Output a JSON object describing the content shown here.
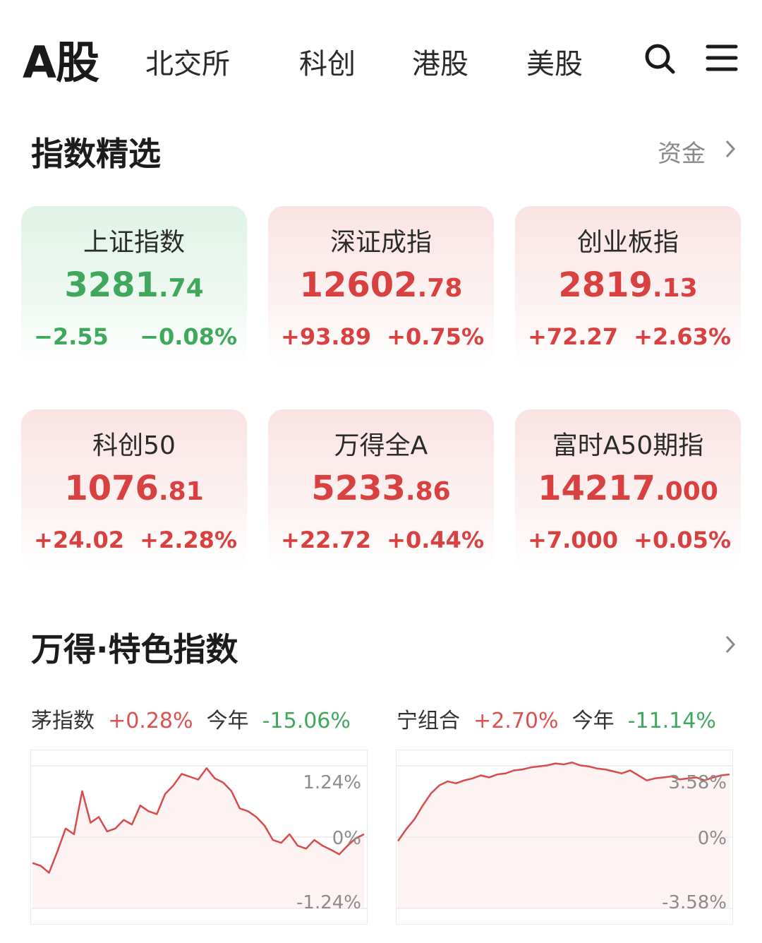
{
  "nav": {
    "active": "A股",
    "tabs": [
      "北交所",
      "科创",
      "港股",
      "美股"
    ],
    "search_icon": "search-icon",
    "menu_icon": "menu-icon"
  },
  "section1": {
    "title": "指数精选",
    "link": "资金"
  },
  "cards": [
    {
      "name": "上证指数",
      "int": "3281",
      "dec": ".74",
      "change": "−2.55",
      "pct": "−0.08%",
      "trend": "down"
    },
    {
      "name": "深证成指",
      "int": "12602",
      "dec": ".78",
      "change": "+93.89",
      "pct": "+0.75%",
      "trend": "up"
    },
    {
      "name": "创业板指",
      "int": "2819",
      "dec": ".13",
      "change": "+72.27",
      "pct": "+2.63%",
      "trend": "up"
    },
    {
      "name": "科创50",
      "int": "1076",
      "dec": ".81",
      "change": "+24.02",
      "pct": "+2.28%",
      "trend": "up"
    },
    {
      "name": "万得全A",
      "int": "5233",
      "dec": ".86",
      "change": "+22.72",
      "pct": "+0.44%",
      "trend": "up"
    },
    {
      "name": "富时A50期指",
      "int": "14217",
      "dec": ".000",
      "change": "+7.000",
      "pct": "+0.05%",
      "trend": "up"
    }
  ],
  "section2": {
    "title": "万得·特色指数"
  },
  "features": [
    {
      "name": "茅指数",
      "day": "+0.28%",
      "ytd_label": "今年",
      "ytd": "-15.06%",
      "axis": {
        "top": "1.24%",
        "mid": "0%",
        "bottom": "-1.24%"
      }
    },
    {
      "name": "宁组合",
      "day": "+2.70%",
      "ytd_label": "今年",
      "ytd": "-11.14%",
      "axis": {
        "top": "3.58%",
        "mid": "0%",
        "bottom": "-3.58%"
      }
    }
  ],
  "colors": {
    "up": "#d94040",
    "down": "#3fa85d",
    "line": "#d94a4a"
  },
  "chart_data": [
    {
      "type": "line",
      "title": "茅指数",
      "ylim": [
        -1.24,
        1.24
      ],
      "x": [
        0,
        1,
        2,
        3,
        4,
        5,
        6,
        7,
        8,
        9,
        10,
        11,
        12,
        13,
        14,
        15,
        16,
        17,
        18,
        19,
        20,
        21,
        22,
        23,
        24,
        25,
        26,
        27,
        28,
        29,
        30,
        31,
        32,
        33,
        34,
        35,
        36,
        37,
        38,
        39,
        40
      ],
      "series": [
        {
          "values": [
            -0.45,
            -0.5,
            -0.62,
            -0.25,
            0.15,
            0.05,
            0.8,
            0.25,
            0.35,
            0.1,
            0.15,
            0.3,
            0.22,
            0.55,
            0.45,
            0.4,
            0.75,
            0.9,
            1.1,
            1.05,
            1.0,
            1.2,
            1.02,
            0.95,
            0.8,
            0.5,
            0.45,
            0.35,
            0.2,
            -0.05,
            -0.1,
            0.05,
            -0.15,
            -0.2,
            -0.05,
            -0.15,
            -0.22,
            -0.3,
            -0.15,
            -0.02,
            0.05
          ]
        }
      ]
    },
    {
      "type": "line",
      "title": "宁组合",
      "ylim": [
        -3.58,
        3.58
      ],
      "x": [
        0,
        1,
        2,
        3,
        4,
        5,
        6,
        7,
        8,
        9,
        10,
        11,
        12,
        13,
        14,
        15,
        16,
        17,
        18,
        19,
        20,
        21,
        22,
        23,
        24,
        25,
        26,
        27,
        28,
        29,
        30,
        31,
        32,
        33,
        34,
        35,
        36,
        37,
        38,
        39,
        40
      ],
      "series": [
        {
          "values": [
            -0.2,
            0.4,
            0.9,
            1.6,
            2.2,
            2.6,
            2.8,
            2.7,
            2.85,
            2.95,
            3.1,
            3.0,
            3.15,
            3.2,
            3.35,
            3.4,
            3.5,
            3.55,
            3.6,
            3.7,
            3.65,
            3.75,
            3.6,
            3.55,
            3.45,
            3.4,
            3.3,
            3.2,
            3.35,
            3.1,
            2.85,
            2.95,
            3.0,
            3.05,
            2.9,
            2.95,
            3.0,
            2.85,
            3.0,
            3.1,
            3.15
          ]
        }
      ]
    }
  ]
}
